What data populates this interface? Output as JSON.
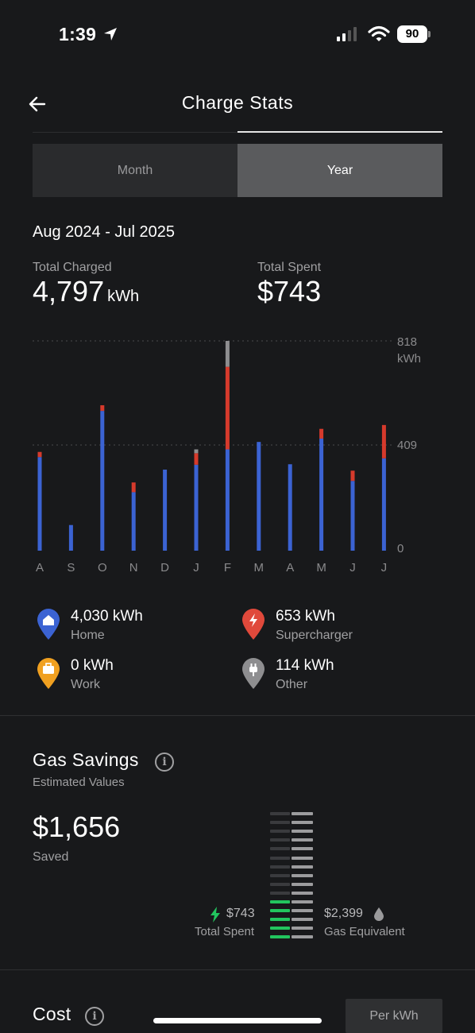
{
  "status_bar": {
    "time": "1:39",
    "battery": "90"
  },
  "header": {
    "title": "Charge Stats"
  },
  "tabs": [
    {
      "label": "Month",
      "active": false
    },
    {
      "label": "Year",
      "active": true
    }
  ],
  "summary": {
    "date_range": "Aug 2024 - Jul 2025",
    "total_charged_label": "Total Charged",
    "total_charged_value": "4,797",
    "total_charged_unit": "kWh",
    "total_spent_label": "Total Spent",
    "total_spent_value": "$743"
  },
  "chart_data": {
    "type": "bar",
    "stacked": true,
    "categories": [
      "A",
      "S",
      "O",
      "N",
      "D",
      "J",
      "F",
      "M",
      "A",
      "M",
      "J",
      "J"
    ],
    "series": [
      {
        "name": "Home",
        "color": "#3b63d3",
        "values": [
          365,
          100,
          545,
          228,
          316,
          335,
          395,
          424,
          337,
          437,
          272,
          360
        ]
      },
      {
        "name": "Supercharger",
        "color": "#d63a2c",
        "values": [
          20,
          0,
          22,
          38,
          0,
          45,
          322,
          0,
          0,
          38,
          40,
          130
        ]
      },
      {
        "name": "Other",
        "color": "#8e8e90",
        "values": [
          0,
          0,
          0,
          0,
          0,
          15,
          101,
          0,
          0,
          0,
          0,
          0
        ]
      }
    ],
    "y_ticks": [
      "818",
      "409",
      "0"
    ],
    "y_unit": "kWh",
    "ylim": [
      0,
      818
    ]
  },
  "legend": [
    {
      "value": "4,030 kWh",
      "label": "Home",
      "icon": "home-icon",
      "color": "#3b63d3"
    },
    {
      "value": "653 kWh",
      "label": "Supercharger",
      "icon": "bolt-icon",
      "color": "#e0493b"
    },
    {
      "value": "0 kWh",
      "label": "Work",
      "icon": "briefcase-icon",
      "color": "#f0a020"
    },
    {
      "value": "114 kWh",
      "label": "Other",
      "icon": "plug-icon",
      "color": "#8e8e90"
    }
  ],
  "gas_savings": {
    "title": "Gas Savings",
    "subtitle": "Estimated Values",
    "saved_value": "$1,656",
    "saved_label": "Saved",
    "spent_value": "$743",
    "spent_label": "Total Spent",
    "gas_value": "$2,399",
    "gas_label": "Gas Equivalent",
    "gauge_total_rows": 15,
    "gauge_filled_rows": 5,
    "fill_color": "#22c55e"
  },
  "cost": {
    "title": "Cost",
    "toggle_label": "Per kWh"
  }
}
